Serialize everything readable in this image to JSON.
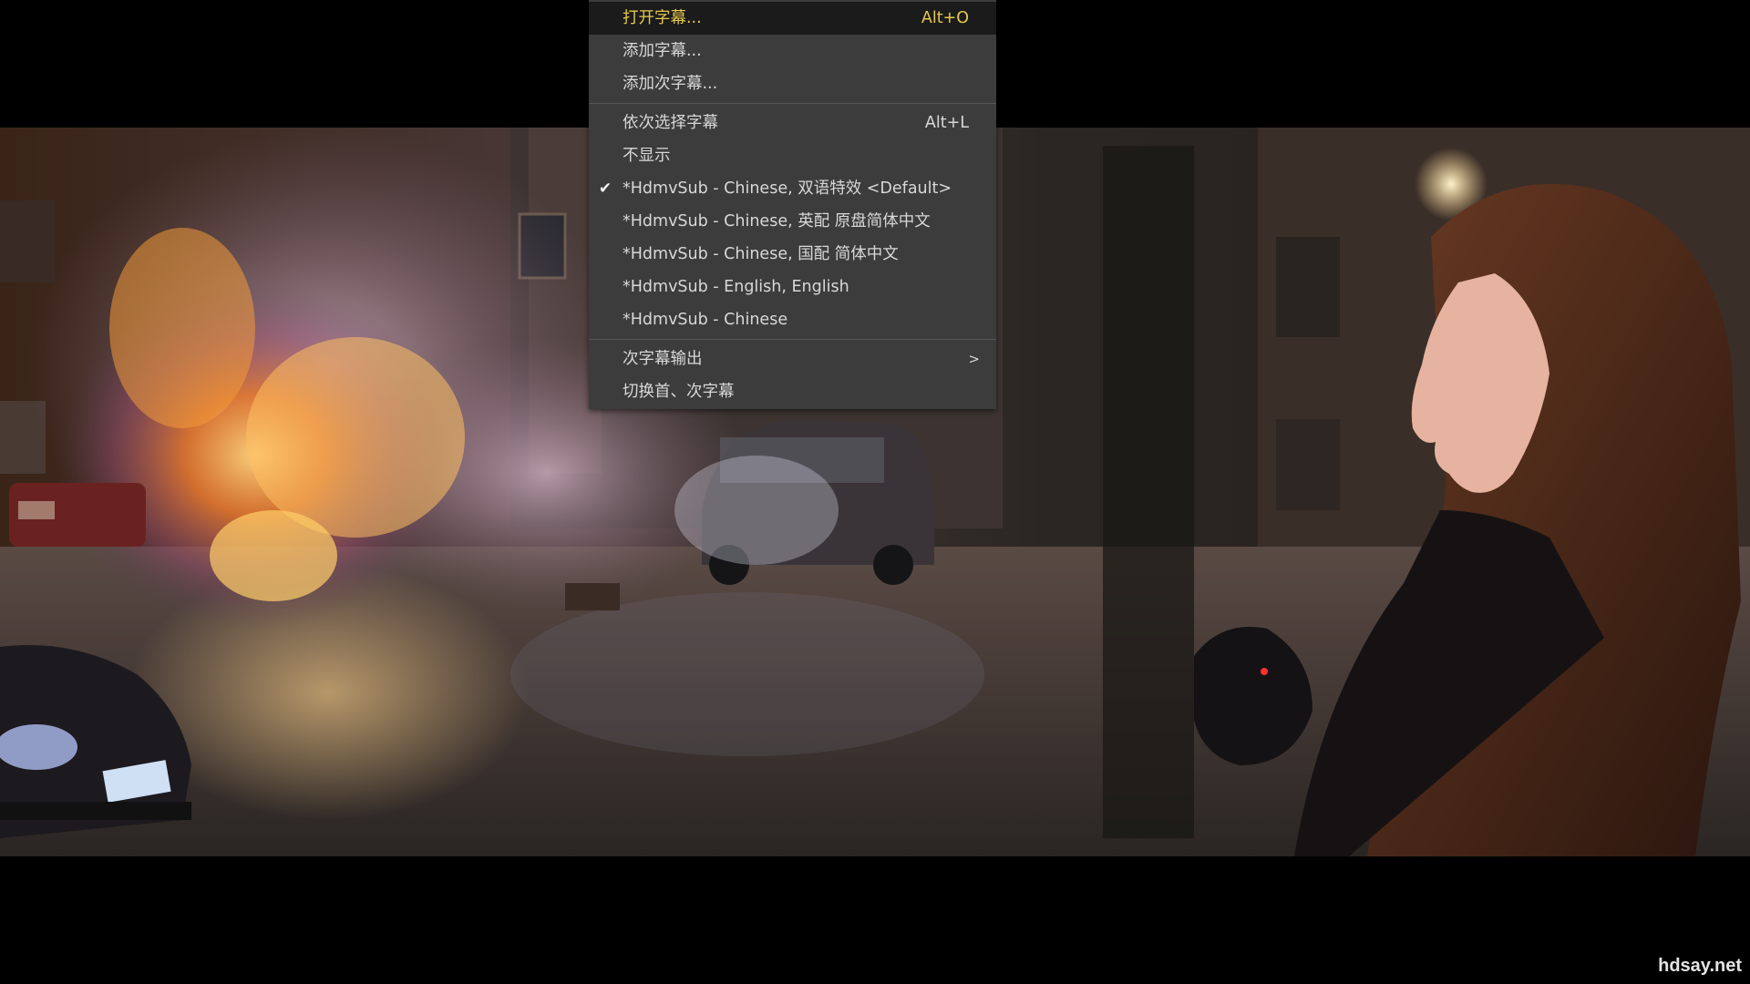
{
  "menu": {
    "items": [
      {
        "label": "打开字幕...",
        "shortcut": "Alt+O"
      },
      {
        "label": "添加字幕...",
        "shortcut": ""
      },
      {
        "label": "添加次字幕...",
        "shortcut": ""
      },
      {
        "label": "依次选择字幕",
        "shortcut": "Alt+L"
      },
      {
        "label": "不显示",
        "shortcut": ""
      },
      {
        "label": "*HdmvSub - Chinese, 双语特效 <Default>",
        "shortcut": "",
        "checked": true
      },
      {
        "label": "*HdmvSub - Chinese, 英配 原盘简体中文",
        "shortcut": ""
      },
      {
        "label": "*HdmvSub - Chinese, 国配 简体中文",
        "shortcut": ""
      },
      {
        "label": "*HdmvSub - English, English",
        "shortcut": ""
      },
      {
        "label": "*HdmvSub - Chinese",
        "shortcut": ""
      },
      {
        "label": "次字幕输出",
        "shortcut": "",
        "submenu": true,
        "arrow": ">"
      },
      {
        "label": "切换首、次字幕",
        "shortcut": ""
      }
    ],
    "check_glyph": "✔",
    "colors": {
      "background": "#3c3c3c",
      "highlight_background": "#1b1b1b",
      "highlight_text": "#e6c84a",
      "text": "#d8d8d8"
    }
  },
  "watermark": "hdsay.net"
}
